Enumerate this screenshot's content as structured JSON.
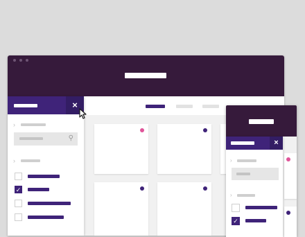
{
  "colors": {
    "header": "#361a3b",
    "accent": "#3f2379",
    "accent_dark": "#331d64",
    "pink_dot": "#e0559a",
    "purple_dot": "#3f2379"
  },
  "main_window": {
    "title": "",
    "panel": {
      "title": "",
      "close_icon": "close-icon",
      "search_icon": "search-icon",
      "checkbox_states": [
        false,
        true,
        false,
        false
      ]
    }
  },
  "small_window": {
    "title": "",
    "panel": {
      "title": "",
      "close_icon": "close-icon",
      "checkbox_states": [
        false,
        true
      ]
    }
  },
  "icons": {
    "close": "×",
    "check": "✓",
    "chevron": "›",
    "search": "⚲"
  }
}
